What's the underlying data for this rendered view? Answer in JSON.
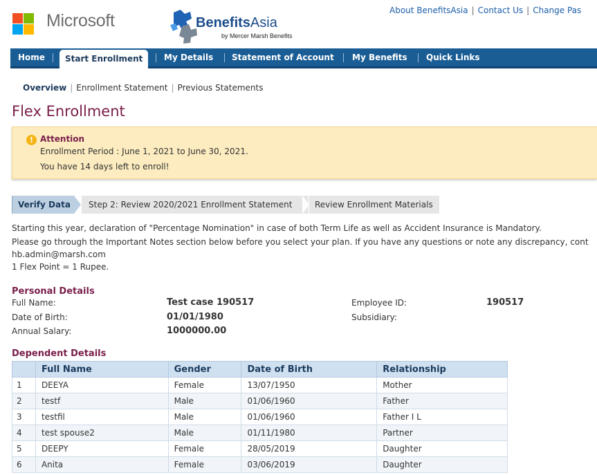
{
  "header": {
    "ms_logo_colors": [
      "#f25022",
      "#7fba00",
      "#00a4ef",
      "#ffb900"
    ],
    "ms_text": "Microsoft",
    "ba_text_bold": "Benefits",
    "ba_text_rest": "Asia",
    "ba_sub": "by Mercer Marsh Benefits",
    "top_links": [
      "About BenefitsAsia",
      "Contact Us",
      "Change Pas"
    ]
  },
  "nav": {
    "items": [
      "Home",
      "Start Enrollment",
      "My Details",
      "Statement of Account",
      "My Benefits",
      "Quick Links"
    ],
    "active": "Start Enrollment"
  },
  "subnav": {
    "items": [
      "Overview",
      "Enrollment Statement",
      "Previous Statements"
    ],
    "active": "Overview"
  },
  "page_title": "Flex Enrollment",
  "alert": {
    "icon": "warning-icon",
    "title": "Attention",
    "line1": "Enrollment Period : June 1, 2021 to June 30, 2021.",
    "line2": "You have 14 days left to enroll!"
  },
  "steps": [
    "Verify Data",
    "Step 2: Review 2020/2021 Enrollment Statement",
    "Review Enrollment Materials"
  ],
  "intro": {
    "line1": "Starting this year, declaration of \"Percentage Nomination\" in case of both Term Life as well as Accident Insurance is Mandatory.",
    "line2": "Please go through the Important Notes section below before you select your plan. If you have any questions or note any discrepancy, cont",
    "line3": "hb.admin@marsh.com",
    "line4": "1 Flex Point = 1 Rupee."
  },
  "personal": {
    "title": "Personal Details",
    "full_name_label": "Full Name:",
    "full_name": "Test case 190517",
    "dob_label": "Date of Birth:",
    "dob": "01/01/1980",
    "salary_label": "Annual Salary:",
    "salary": "1000000.00",
    "emp_id_label": "Employee ID:",
    "emp_id": "190517",
    "subsidiary_label": "Subsidiary:",
    "subsidiary": ""
  },
  "dependents": {
    "title": "Dependent Details",
    "columns": [
      "",
      "Full Name",
      "Gender",
      "Date of Birth",
      "Relationship"
    ],
    "rows": [
      [
        "1",
        "DEEYA",
        "Female",
        "13/07/1950",
        "Mother"
      ],
      [
        "2",
        "testf",
        "Male",
        "01/06/1960",
        "Father"
      ],
      [
        "3",
        "testfil",
        "Male",
        "01/06/1960",
        "Father I L"
      ],
      [
        "4",
        "test spouse2",
        "Male",
        "01/11/1980",
        "Partner"
      ],
      [
        "5",
        "DEEPY",
        "Female",
        "28/05/2019",
        "Daughter"
      ],
      [
        "6",
        "Anita",
        "Female",
        "03/06/2019",
        "Daughter"
      ]
    ]
  },
  "colors": {
    "nav_bg": "#1a5d95",
    "title_color": "#7a1e4a",
    "alert_bg": "#fcecc0",
    "link_color": "#1c5ea8"
  }
}
